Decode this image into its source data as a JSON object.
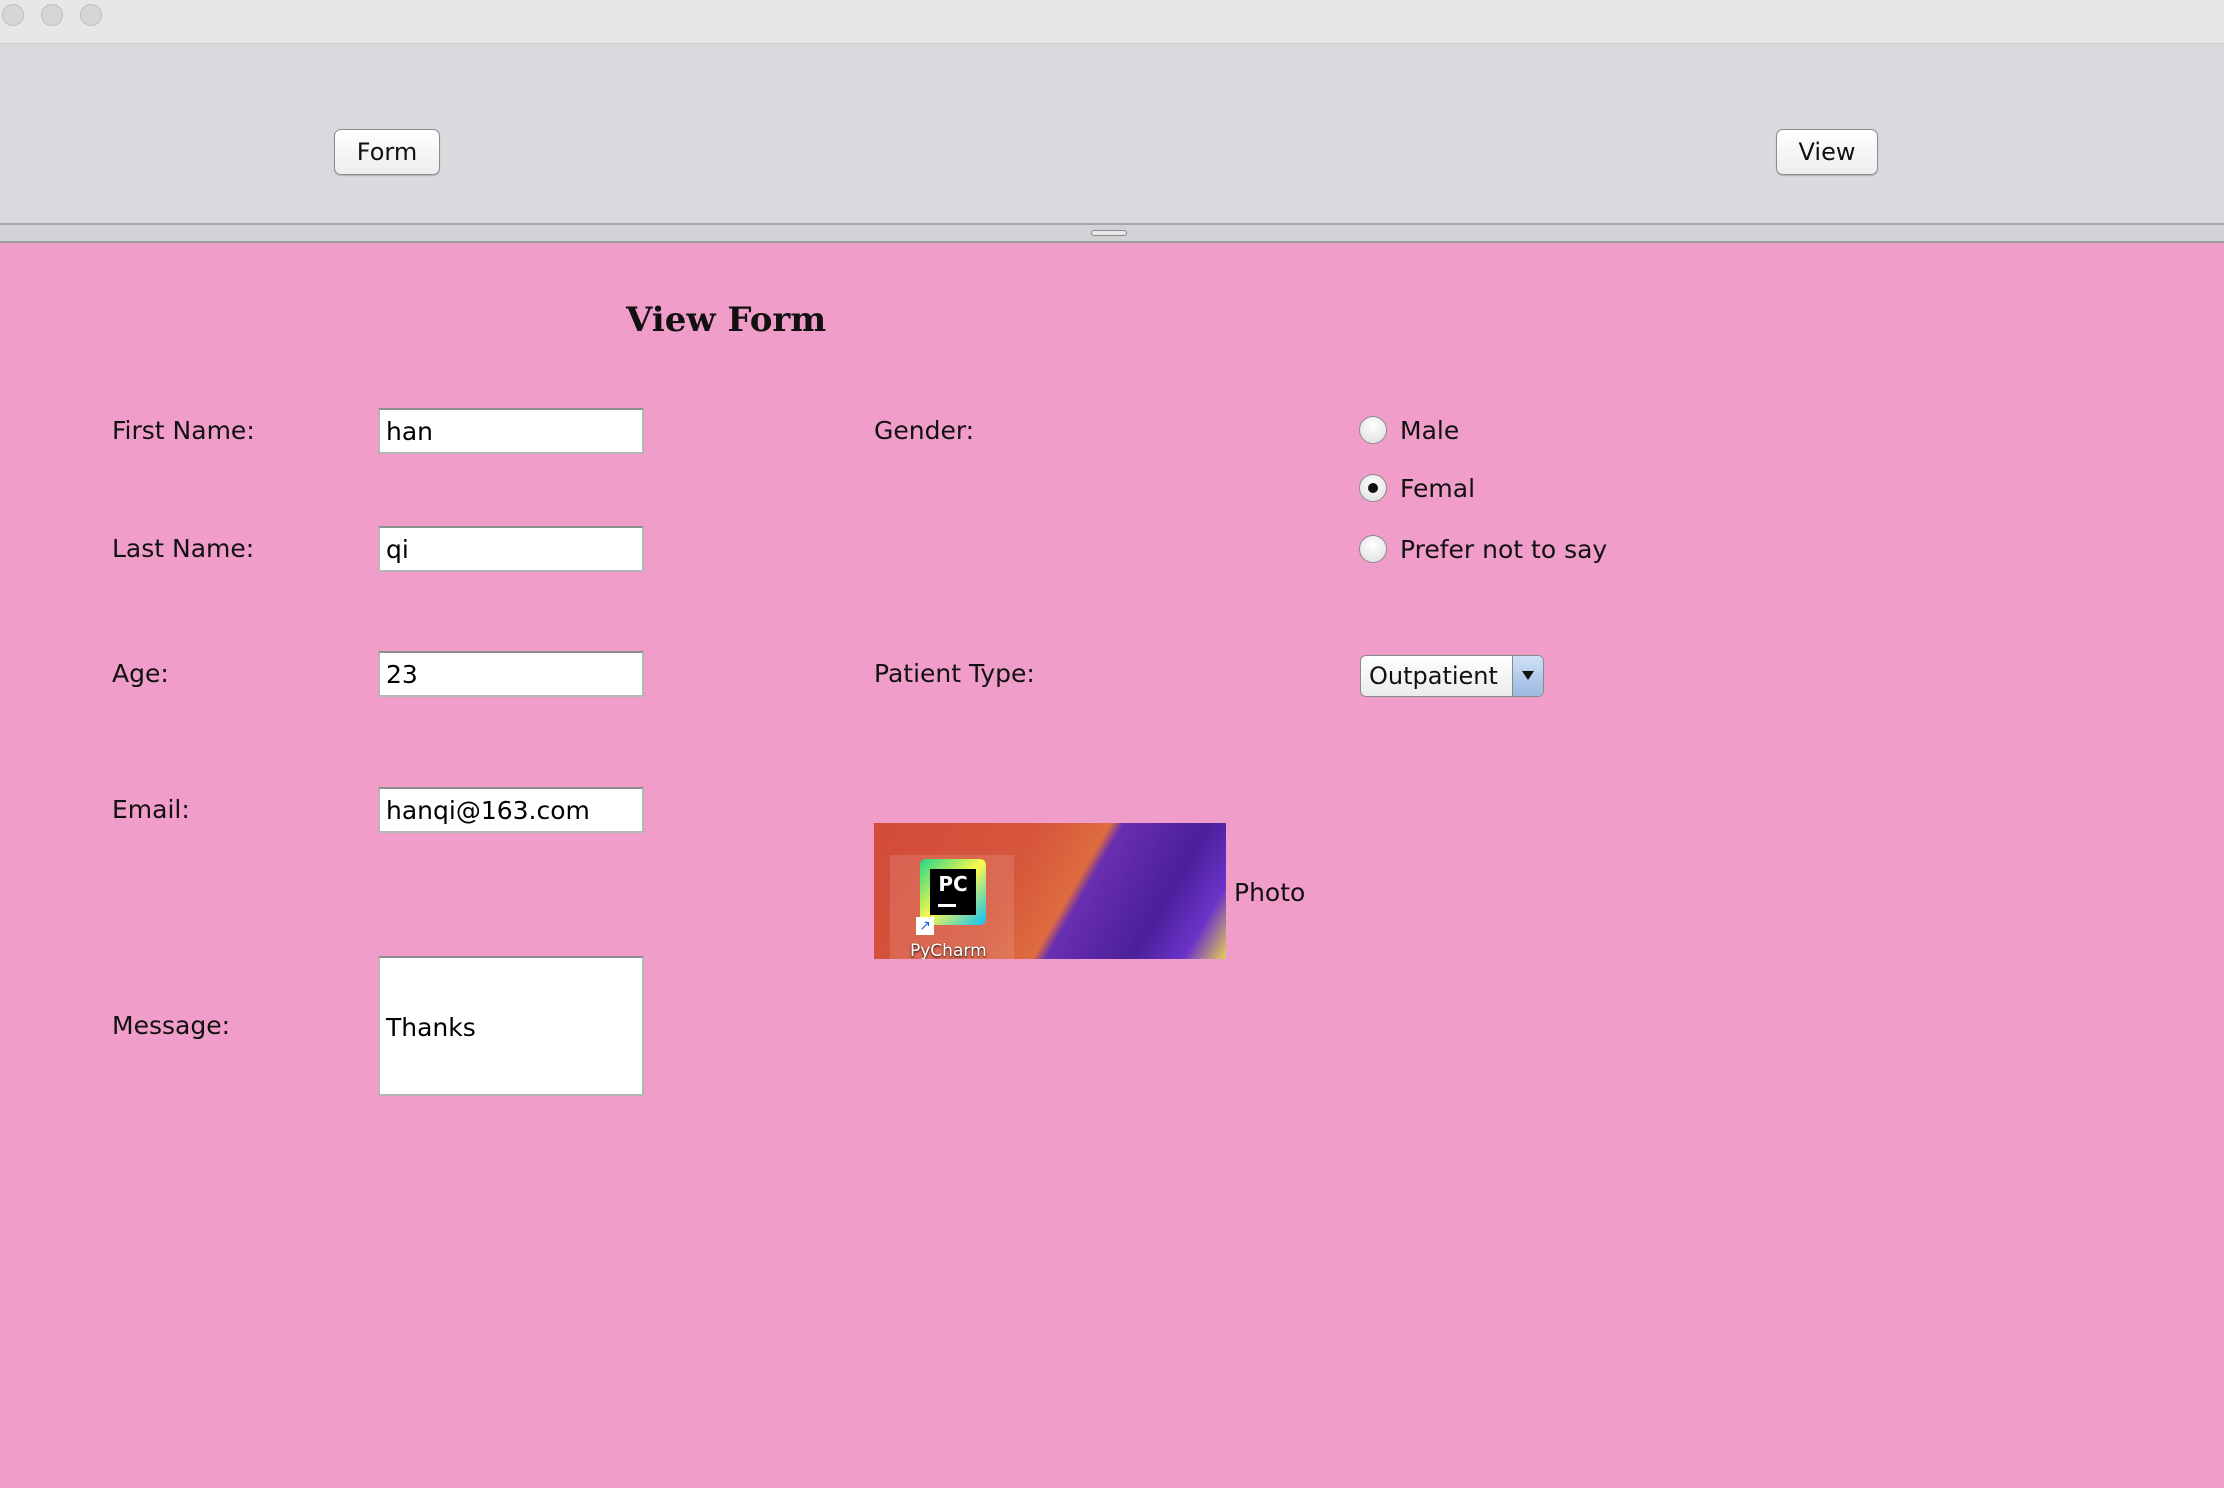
{
  "toolbar": {
    "form_button": "Form",
    "view_button": "View"
  },
  "form": {
    "title": "View Form",
    "first_name": {
      "label": "First Name:",
      "value": "han"
    },
    "last_name": {
      "label": "Last Name:",
      "value": "qi"
    },
    "age": {
      "label": "Age:",
      "value": "23"
    },
    "email": {
      "label": "Email:",
      "value": "hanqi@163.com"
    },
    "message": {
      "label": "Message:",
      "value": "Thanks"
    },
    "gender": {
      "label": "Gender:",
      "options": [
        "Male",
        "Femal",
        "Prefer not to say"
      ],
      "selected": "Femal"
    },
    "patient_type": {
      "label": "Patient Type:",
      "selected": "Outpatient"
    },
    "photo": {
      "label": "Photo",
      "icon_text": "PC",
      "icon_caption": "PyCharm",
      "icon": "pycharm-icon"
    }
  },
  "colors": {
    "panel_background": "#f19dc9",
    "toolbar_background": "#d9dade"
  }
}
